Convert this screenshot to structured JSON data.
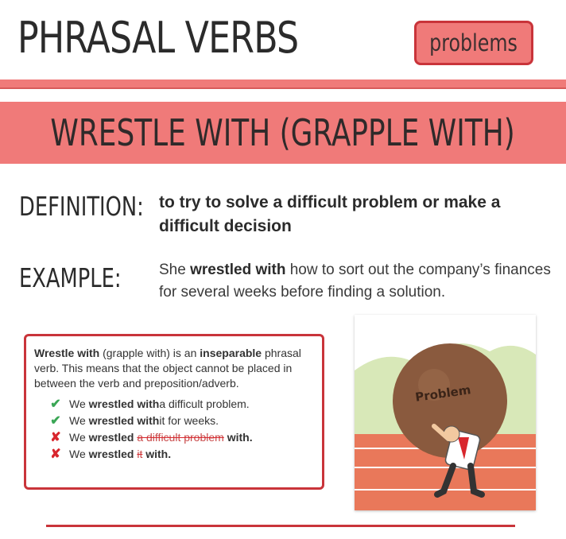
{
  "header": {
    "title": "PHRASAL VERBS",
    "badge": "problems"
  },
  "verb": {
    "heading": "WRESTLE WITH (GRAPPLE WITH)"
  },
  "definition": {
    "label": "DEFINITION:",
    "text": "to try to solve a difficult problem or make a difficult decision"
  },
  "example": {
    "label": "EXAMPLE:",
    "pre": "She ",
    "bold": "wrestled with",
    "post": " how to sort out the company’s finances for several weeks before finding a solution."
  },
  "note": {
    "intro_bold_1": "Wrestle with",
    "intro_1": " (grapple with) is an ",
    "intro_bold_2": "inseparable",
    "intro_2": " phrasal verb. This means that the object cannot be placed in between the verb and preposition/adverb.",
    "examples": [
      {
        "mark": "✔",
        "pre": "We ",
        "bold": "wrestled with",
        "post": " a difficult problem.",
        "strike": ""
      },
      {
        "mark": "✔",
        "pre": "We ",
        "bold": "wrestled with",
        "post": " it for weeks.",
        "strike": ""
      },
      {
        "mark": "✘",
        "pre": "We ",
        "bold": "wrestled",
        "strike": "a difficult problem",
        "post_bold": "with."
      },
      {
        "mark": "✘",
        "pre": "We ",
        "bold": "wrestled",
        "strike": "it",
        "post_bold": "with."
      }
    ]
  },
  "illustration": {
    "boulder_label": "Problem"
  },
  "colors": {
    "accent": "#f07a79",
    "border": "#c9343a",
    "check": "#3aa655",
    "cross": "#d8262d"
  }
}
